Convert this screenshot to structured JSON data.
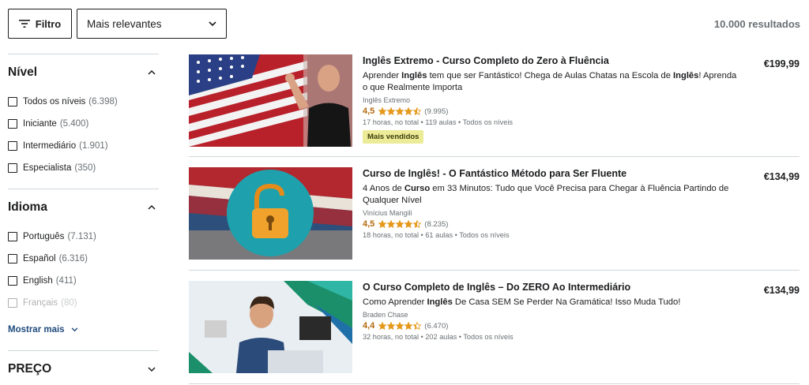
{
  "toolbar": {
    "filter_label": "Filtro",
    "sort_value": "Mais relevantes",
    "results": "10.000 resultados"
  },
  "sidebar": {
    "level": {
      "title": "Nível",
      "options": [
        {
          "label": "Todos os níveis",
          "count": "(6.398)"
        },
        {
          "label": "Iniciante",
          "count": "(5.400)"
        },
        {
          "label": "Intermediário",
          "count": "(1.901)"
        },
        {
          "label": "Especialista",
          "count": "(350)"
        }
      ]
    },
    "language": {
      "title": "Idioma",
      "options": [
        {
          "label": "Português",
          "count": "(7.131)"
        },
        {
          "label": "Español",
          "count": "(6.316)"
        },
        {
          "label": "English",
          "count": "(411)"
        },
        {
          "label": "Français",
          "count": "(80)"
        }
      ],
      "show_more": "Mostrar mais"
    },
    "price": {
      "title": "PREÇO"
    }
  },
  "courses": [
    {
      "title": "Inglês Extremo - Curso Completo do Zero à Fluência",
      "desc_parts": [
        "Aprender ",
        "Inglês",
        " tem que ser Fantástico! Chega de Aulas Chatas na Escola de ",
        "Inglês",
        "! Aprenda o que Realmente Importa"
      ],
      "author": "Inglês Extremo",
      "rating": "4,5",
      "reviews": "(9.995)",
      "meta": "17 horas, no total • 119 aulas • Todos os níveis",
      "badge": "Mais vendidos",
      "price": "€199,99",
      "stars": 4.5
    },
    {
      "title": "Curso de Inglês! - O Fantástico Método para Ser Fluente",
      "desc_parts": [
        "4 Anos de ",
        "Curso",
        " em 33 Minutos: Tudo que Você Precisa para Chegar à Fluência Partindo de Qualquer Nível"
      ],
      "author": "Vinícius Mangili",
      "rating": "4,5",
      "reviews": "(8.235)",
      "meta": "18 horas, no total • 61 aulas • Todos os níveis",
      "price": "€134,99",
      "stars": 4.5
    },
    {
      "title": "O Curso Completo de Inglês – Do ZERO Ao Intermediário",
      "desc_parts": [
        "Como Aprender ",
        "Inglês",
        " De Casa SEM Se Perder Na Gramática! Isso Muda Tudo!"
      ],
      "author": "Braden Chase",
      "rating": "4,4",
      "reviews": "(6.470)",
      "meta": "32 horas, no total • 202 aulas • Todos os níveis",
      "price": "€134,99",
      "stars": 4.4
    }
  ],
  "colors": {
    "star": "#e59819",
    "rating_text": "#b4690e",
    "link": "#1f4a7d",
    "badge_bg": "#eceb98"
  },
  "icons": {
    "filter": "filter-lines-icon",
    "dropdown": "chevron-down-icon",
    "collapse": "chevron-up-icon",
    "star": "star-icon"
  }
}
